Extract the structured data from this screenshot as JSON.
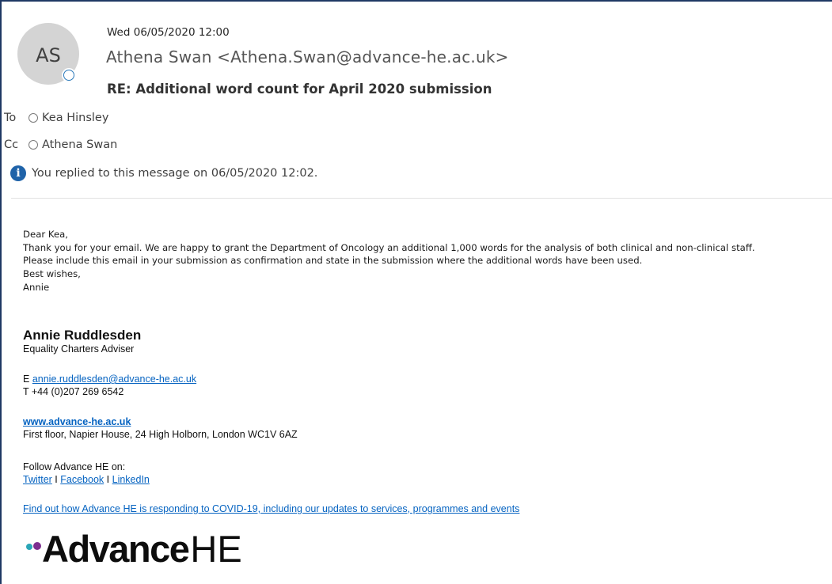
{
  "header": {
    "avatar_initials": "AS",
    "date": "Wed 06/05/2020 12:00",
    "from": "Athena Swan <Athena.Swan@advance-he.ac.uk>",
    "subject": "RE: Additional word count for April 2020 submission"
  },
  "recipients": {
    "to_label": "To",
    "to_name": "Kea Hinsley",
    "cc_label": "Cc",
    "cc_name": "Athena Swan"
  },
  "info_bar": {
    "icon": "info-icon",
    "text": "You replied to this message on 06/05/2020 12:02."
  },
  "body": {
    "greeting": "Dear Kea,",
    "line1": "Thank you for your email. We are happy to grant the Department of Oncology an additional 1,000 words for the analysis of both clinical and non-clinical staff.",
    "line2": "Please include this email in your submission as confirmation and state in the submission where the additional words have been used.",
    "closing": "Best wishes,",
    "sender_first": "Annie"
  },
  "signature": {
    "name": "Annie Ruddlesden",
    "title": "Equality Charters Adviser",
    "email_prefix": "E",
    "email": "annie.ruddlesden@advance-he.ac.uk",
    "phone": "T +44 (0)207 269 6542",
    "website": "www.advance-he.ac.uk",
    "address": "First floor, Napier House, 24 High Holborn, London WC1V 6AZ",
    "follow_text": "Follow Advance HE on:",
    "twitter": "Twitter",
    "separator": "I",
    "facebook": "Facebook",
    "linkedin": "LinkedIn",
    "covid_link": "Find out how Advance HE is responding to COVID-19, including our updates to services, programmes and events",
    "logo_bold": "Advance",
    "logo_light": "HE"
  },
  "colors": {
    "link": "#0563c1",
    "info_icon": "#1f63a9",
    "avatar_bg": "#d4d4d4",
    "logo_dot_teal": "#2aa6b7",
    "logo_dot_purple": "#7d2f8f"
  }
}
